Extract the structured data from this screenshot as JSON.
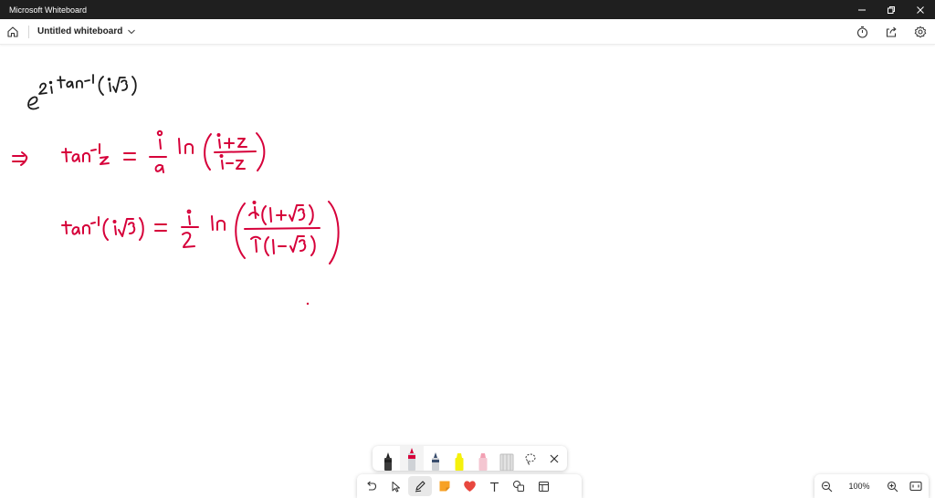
{
  "window": {
    "title": "Microsoft Whiteboard",
    "controls": [
      "minimize-icon",
      "restore-icon",
      "close-icon"
    ]
  },
  "header": {
    "board_title": "Untitled whiteboard",
    "left_icons": [
      "home-icon",
      "chevron-down-icon"
    ],
    "right_icons": [
      "timer-icon",
      "share-icon",
      "settings-icon"
    ]
  },
  "canvas": {
    "ink_color": "#d6003a",
    "ink_lines": [
      "e^{2i tan^{-1}(i√3)}",
      "⇒ tan^{-1} z = (i/2) ln( (i+z)/(i-z) )",
      "tan^{-1}(i√3) = (i/2) ln( i(1+√3) / i(1-√3) )"
    ]
  },
  "pen_tray": {
    "pens": [
      {
        "name": "black-pen",
        "color": "#222222"
      },
      {
        "name": "red-pen",
        "color": "#d6003a",
        "selected": true
      },
      {
        "name": "blue-pen",
        "color": "#3a4e6e"
      },
      {
        "name": "yellow-highlighter",
        "color": "#f5f10c"
      },
      {
        "name": "pink-highlighter",
        "color": "#f2a0b3"
      },
      {
        "name": "ruler",
        "color": "#bdbdbd"
      }
    ],
    "tools": [
      "lasso-icon",
      "close-icon"
    ]
  },
  "toolbar": {
    "tools": [
      "undo-icon",
      "select-icon",
      "pen-icon",
      "sticky-note-icon",
      "reaction-icon",
      "text-icon",
      "shapes-icon",
      "templates-icon"
    ],
    "active_tool": "pen-icon",
    "sticky_color": "#f7a125",
    "reaction_color": "#e8473e"
  },
  "zoom": {
    "level": "100%",
    "icons": [
      "zoom-out-icon",
      "zoom-in-icon",
      "fit-to-screen-icon"
    ]
  }
}
